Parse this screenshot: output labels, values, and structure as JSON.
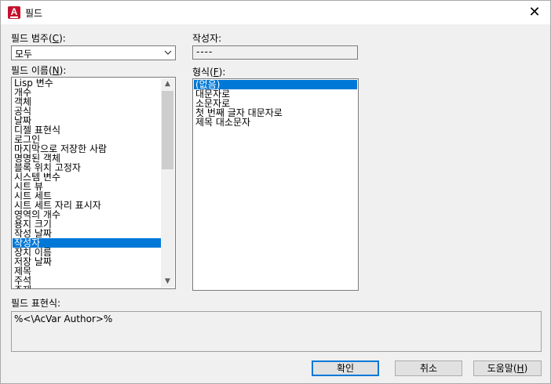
{
  "window": {
    "title": "필드",
    "app_icon": "A",
    "close_icon": "close-icon"
  },
  "field_category": {
    "label_pre": "필드 범주(",
    "label_key": "C",
    "label_post": "):",
    "value": "모두"
  },
  "author": {
    "label": "작성자:",
    "value": "----"
  },
  "field_names": {
    "label_pre": "필드 이름(",
    "label_key": "N",
    "label_post": "):",
    "items": [
      "Lisp 변수",
      "개수",
      "객체",
      "공식",
      "날짜",
      "디젤 표현식",
      "로그인",
      "마지막으로 저장한 사람",
      "명명된 객체",
      "블록 위치 고정자",
      "시스템 변수",
      "시트 뷰",
      "시트 세트",
      "시트 세트 자리 표시자",
      "영역의 개수",
      "용지 크기",
      "작성 날짜",
      "작성자",
      "장치 이름",
      "저장 날짜",
      "제목",
      "주석",
      "주제"
    ],
    "selected_index": 17
  },
  "format": {
    "label_pre": "형식(",
    "label_key": "F",
    "label_post": "):",
    "items": [
      "(없음)",
      "대문자로",
      "소문자로",
      "첫 번째 글자 대문자로",
      "제목 대소문자"
    ],
    "selected_index": 0
  },
  "field_expression": {
    "label": "필드 표현식:",
    "value": "%<\\AcVar Author>%"
  },
  "buttons": {
    "ok": "확인",
    "cancel": "취소",
    "help_pre": "도움말(",
    "help_key": "H",
    "help_post": ")"
  }
}
